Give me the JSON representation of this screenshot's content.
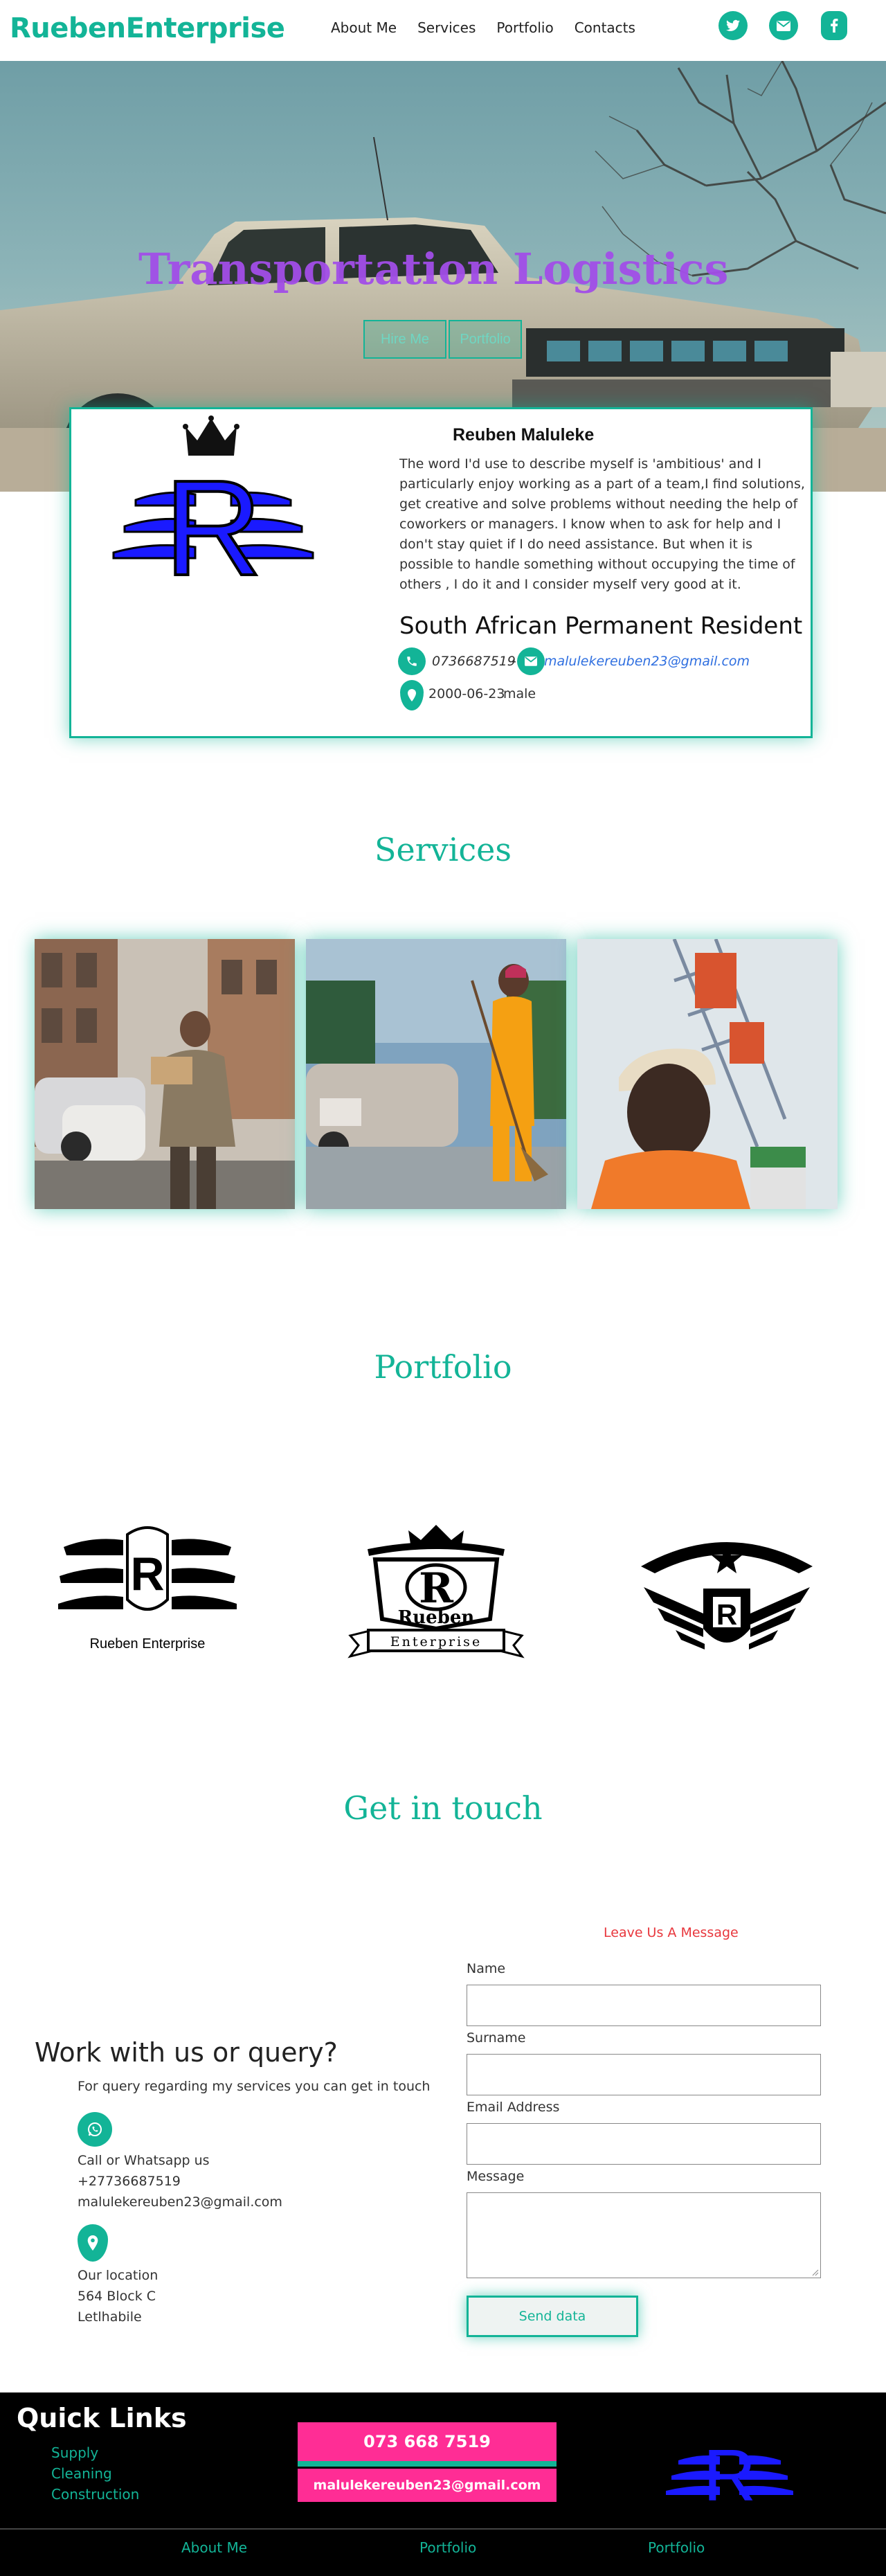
{
  "nav": {
    "brand": "RuebenEnterprise",
    "links": [
      "About Me",
      "Services",
      "Portfolio",
      "Contacts"
    ],
    "social_icons": [
      "twitter-icon",
      "envelope-icon",
      "facebook-icon"
    ]
  },
  "hero": {
    "title": "Transportation Logistics",
    "button_1": "Hire Me",
    "button_2": "Portfolio"
  },
  "profile": {
    "name": "Reuben Maluleke",
    "bio": "The word I'd use to describe myself is 'ambitious' and I particularly enjoy working as a part of a team,I find solutions, get creative and solve problems without needing the help of coworkers or managers. I know when to ask for help and I don't stay quiet if I do need assistance. But when it is possible to handle something without occupying the time of others , I do it and I consider myself very good at it.",
    "status": "South African Permanent Resident",
    "phone": "0736687519",
    "phone_sep": "-",
    "email": "malulekereuben23@gmail.com",
    "dob": "2000-06-23",
    "gender": "male",
    "logo_letter": "R"
  },
  "services": {
    "title": "Services"
  },
  "portfolio": {
    "title": "Portfolio",
    "logo1_letter": "R",
    "logo1_text": "Rueben Enterprise",
    "logo2_letter": "R",
    "logo2_name": "Rueben",
    "logo2_banner": "Enterprise",
    "logo3_letter": "R"
  },
  "contact": {
    "title": "Get in touch",
    "heading": "Work with us or query?",
    "subtext": "For query regarding my services you can get in touch",
    "call_label": "Call or Whatsapp us",
    "call_number": "+27736687519",
    "call_email": "malulekereuben23@gmail.com",
    "location_label": "Our location",
    "location_line1": "564 Block C",
    "location_line2": "Letlhabile",
    "form_heading": "Leave Us A Message",
    "label_name": "Name",
    "label_surname": "Surname",
    "label_email": "Email Address",
    "label_message": "Message",
    "submit": "Send data"
  },
  "footer": {
    "title": "Quick Links",
    "links": [
      "Supply",
      "Cleaning",
      "Construction"
    ],
    "phone_button": "073 668 7519",
    "email_button": "malulekereuben23@gmail.com",
    "bottom_links": [
      "About Me",
      "Portfolio",
      "Portfolio"
    ],
    "logo_letter": "R"
  },
  "colors": {
    "accent": "#13b497",
    "hero_title": "#a24ee8",
    "pink": "#ff2d95",
    "logo_blue": "#1a1aff",
    "message_red": "#e8373d"
  }
}
